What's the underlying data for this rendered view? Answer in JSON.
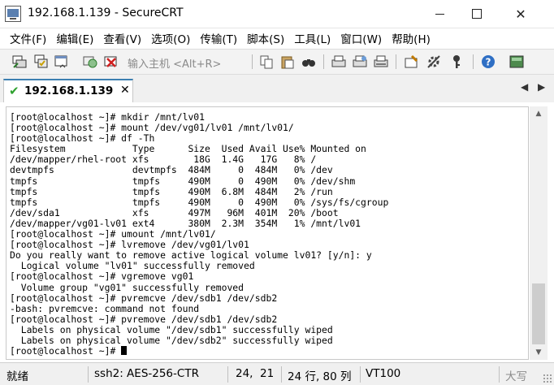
{
  "window": {
    "title": "192.168.1.139 - SecureCRT"
  },
  "menu": [
    "文件(F)",
    "编辑(E)",
    "查看(V)",
    "选项(O)",
    "传输(T)",
    "脚本(S)",
    "工具(L)",
    "窗口(W)",
    "帮助(H)"
  ],
  "toolbar": {
    "quick_connect_placeholder": "输入主机 <Alt+R>"
  },
  "tab": {
    "label": "192.168.1.139",
    "close": "✕"
  },
  "terminal": {
    "lines": [
      "[root@localhost ~]# mkdir /mnt/lv01",
      "[root@localhost ~]# mount /dev/vg01/lv01 /mnt/lv01/",
      "[root@localhost ~]# df -Th",
      "Filesystem            Type      Size  Used Avail Use% Mounted on",
      "/dev/mapper/rhel-root xfs        18G  1.4G   17G   8% /",
      "devtmpfs              devtmpfs  484M     0  484M   0% /dev",
      "tmpfs                 tmpfs     490M     0  490M   0% /dev/shm",
      "tmpfs                 tmpfs     490M  6.8M  484M   2% /run",
      "tmpfs                 tmpfs     490M     0  490M   0% /sys/fs/cgroup",
      "/dev/sda1             xfs       497M   96M  401M  20% /boot",
      "/dev/mapper/vg01-lv01 ext4      380M  2.3M  354M   1% /mnt/lv01",
      "[root@localhost ~]# umount /mnt/lv01/",
      "[root@localhost ~]# lvremove /dev/vg01/lv01",
      "Do you really want to remove active logical volume lv01? [y/n]: y",
      "  Logical volume \"lv01\" successfully removed",
      "[root@localhost ~]# vgremove vg01",
      "  Volume group \"vg01\" successfully removed",
      "[root@localhost ~]# pvremcve /dev/sdb1 /dev/sdb2",
      "-bash: pvremcve: command not found",
      "[root@localhost ~]# pvremove /dev/sdb1 /dev/sdb2",
      "  Labels on physical volume \"/dev/sdb1\" successfully wiped",
      "  Labels on physical volume \"/dev/sdb2\" successfully wiped",
      "[root@localhost ~]# "
    ]
  },
  "status": {
    "ready": "就绪",
    "session": "ssh2: AES-256-CTR",
    "cursor": "24,  21",
    "size": "24 行, 80 列",
    "emulation": "VT100",
    "caps": "大写"
  }
}
